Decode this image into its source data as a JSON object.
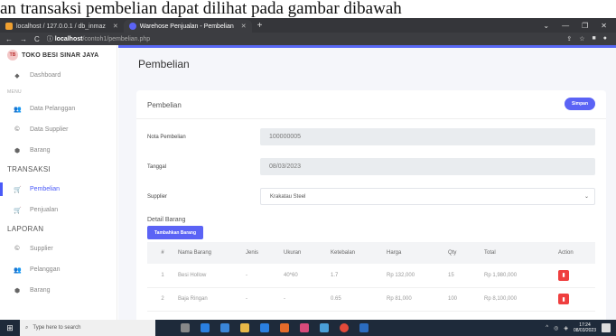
{
  "caption": "an transaksi pembelian dapat dilihat pada gambar dibawah",
  "browser": {
    "tabs": [
      {
        "label": "localhost / 127.0.0.1 / db_inmaz",
        "active": false
      },
      {
        "label": "Warehose Penjualan - Pembelian",
        "active": true
      }
    ],
    "new_tab": "+",
    "url_host": "localhost",
    "url_path": "/contoh1/pembelian.php"
  },
  "sidebar": {
    "brand": "TOKO BESI SINAR JAYA",
    "dashboard": "Dashboard",
    "menu_head": "MENU",
    "menu": [
      {
        "label": "Data Pelanggan",
        "icon": "users-icon"
      },
      {
        "label": "Data Supplier",
        "icon": "copyright-icon"
      },
      {
        "label": "Barang",
        "icon": "box-icon"
      }
    ],
    "transaksi_head": "TRANSAKSI",
    "transaksi": [
      {
        "label": "Pembelian",
        "icon": "cart-icon",
        "active": true
      },
      {
        "label": "Penjualan",
        "icon": "cart-icon",
        "active": false
      }
    ],
    "laporan_head": "LAPORAN",
    "laporan": [
      {
        "label": "Supplier",
        "icon": "copyright-icon"
      },
      {
        "label": "Pelanggan",
        "icon": "users-icon"
      },
      {
        "label": "Barang",
        "icon": "box-icon"
      }
    ]
  },
  "main": {
    "page_title": "Pembelian",
    "card_title": "Pembelian",
    "save_label": "Simpan",
    "nota_label": "Nota Pembelian",
    "nota_value": "100000005",
    "tanggal_label": "Tanggal",
    "tanggal_value": "08/03/2023",
    "supplier_label": "Supplier",
    "supplier_value": "Krakatau Steel",
    "detail_label": "Detail Barang",
    "add_label": "Tambahkan Barang",
    "table": {
      "headers": [
        "#",
        "Nama Barang",
        "Jenis",
        "Ukuran",
        "Ketebalan",
        "Harga",
        "Qty",
        "Total",
        "Action"
      ],
      "rows": [
        [
          "1",
          "Besi Hollow",
          "-",
          "40*60",
          "1.7",
          "Rp 132,000",
          "15",
          "Rp 1,980,000"
        ],
        [
          "2",
          "Baja Ringan",
          "-",
          "-",
          "0.65",
          "Rp 81,000",
          "100",
          "Rp 8,100,000"
        ]
      ]
    }
  },
  "taskbar": {
    "search_placeholder": "Type here to search",
    "time": "17:24",
    "date": "08/03/2023"
  },
  "colors": {
    "accent": "#5b63f5",
    "danger": "#ef3f3f",
    "taskbar": "#1e2a3a"
  }
}
